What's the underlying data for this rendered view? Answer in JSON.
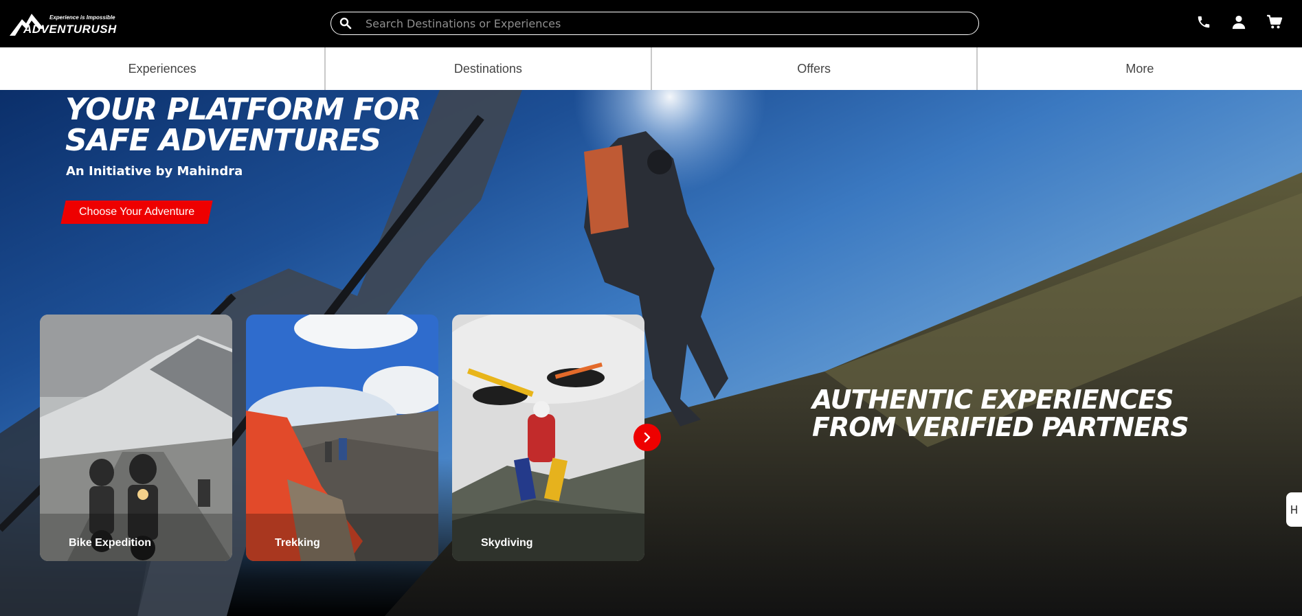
{
  "header": {
    "logo_tagline": "Experience is Impossible",
    "logo_text": "ADVENTURUSH",
    "search_placeholder": "Search Destinations or Experiences",
    "icons": [
      "search-icon",
      "phone-icon",
      "user-icon",
      "cart-icon"
    ]
  },
  "nav": {
    "items": [
      {
        "label": "Experiences"
      },
      {
        "label": "Destinations"
      },
      {
        "label": "Offers"
      },
      {
        "label": "More"
      }
    ]
  },
  "hero": {
    "title": "YOUR PLATFORM FOR\nSAFE ADVENTURES",
    "subtitle": "An Initiative by Mahindra",
    "cta_label": "Choose Your Adventure",
    "right_text": "AUTHENTIC EXPERIENCES\nFROM VERIFIED PARTNERS"
  },
  "cards": [
    {
      "label": "Bike Expedition"
    },
    {
      "label": "Trekking"
    },
    {
      "label": "Skydiving"
    }
  ],
  "colors": {
    "accent": "#ee0000",
    "header_bg": "#000000",
    "nav_bg": "#ffffff"
  }
}
